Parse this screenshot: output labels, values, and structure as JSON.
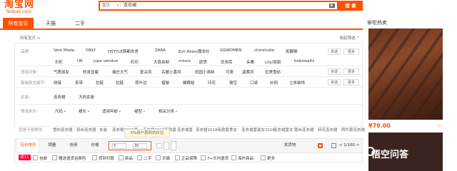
{
  "header": {
    "logo_zh": "淘宝网",
    "logo_en": "Taobao.com",
    "search_scope": "宝贝",
    "search_query": "连衣裙",
    "search_button": "搜 索"
  },
  "tabs": [
    "所有宝贝",
    "天猫",
    "二手"
  ],
  "breadcrumb": "所有宝贝 >",
  "collapse_label": "收起筛选 ^",
  "filters": [
    {
      "label": "品牌:",
      "values": [
        "Vero Moda",
        "ONLY",
        "HSTYLE韩都衣舍",
        "ZARA",
        "Evil Alien/魔衣社",
        "GGWOMEN",
        "chinstudio",
        "笑醒猴"
      ],
      "values2": [
        "乐町",
        "UR",
        "jupe vendue",
        "町印",
        "大喜自制",
        "miuco",
        "欧思",
        "优衣库",
        "朵雅",
        "Lily/丽丽",
        "bobowaltz"
      ],
      "buttons": [
        "多选",
        "更多"
      ]
    },
    {
      "label": "适用对象:",
      "values": [
        "气质淑女",
        "修身显瘦",
        "端庄大气",
        "复古风",
        "名媛小香风",
        "田园小清新",
        "可爱",
        "温柔风",
        "优美雪纺"
      ],
      "buttons": [
        "多选",
        "更多"
      ]
    },
    {
      "label": "服装款式细节:",
      "values": [
        "拼接",
        "系带",
        "拉链",
        "拉链",
        "荷叶边",
        "褶皱",
        "蝴蝶结",
        "印花",
        "镂空",
        "口袋",
        "纱网",
        "立体装饰"
      ],
      "buttons": [
        "多选",
        "更多"
      ]
    },
    {
      "label": "女装:",
      "values": [
        "连衣裙",
        "大码女装"
      ],
      "buttons": []
    },
    {
      "label": "筛选条件:",
      "dropdowns": [
        "尺码",
        "裙长",
        "适用年龄",
        "裙型",
        "相关分类"
      ]
    }
  ],
  "related": {
    "label": "您是不是想找:",
    "values": [
      "雪纺连衣裙",
      "真丝连衣裙",
      "女装",
      "连衣裙2018夏",
      "连衣裙2018新款夏",
      "连衣裙夏",
      "连衣裙2018新款夏季女",
      "连衣裙夏装女2018",
      "连衣裙夏女",
      "蕾丝连衣裙",
      "碎花连衣裙",
      "两件套连衣裙",
      "长袖连衣裙"
    ]
  },
  "price_tip": "3%用户喜欢的价位",
  "sort": {
    "items": [
      "综合排序",
      "销量",
      "信用",
      "价格"
    ],
    "price_from": "¥",
    "price_to": "35",
    "ship_from": "发货地",
    "page": "1/100",
    "prev": "<",
    "next": ">"
  },
  "checkboxes": {
    "badge": "双11",
    "items": [
      "包邮",
      "赠送退货运费险",
      "货到付款",
      "新品",
      "二手",
      "天猫",
      "正品保障",
      "7+天内退货",
      "海外商品",
      "更多"
    ]
  },
  "sidebar": {
    "title": "掌柜热卖",
    "price": "¥79.00"
  },
  "watermark": "悟空问答",
  "colors": {
    "accent": "#ff5000",
    "badge": "#ff0036"
  }
}
